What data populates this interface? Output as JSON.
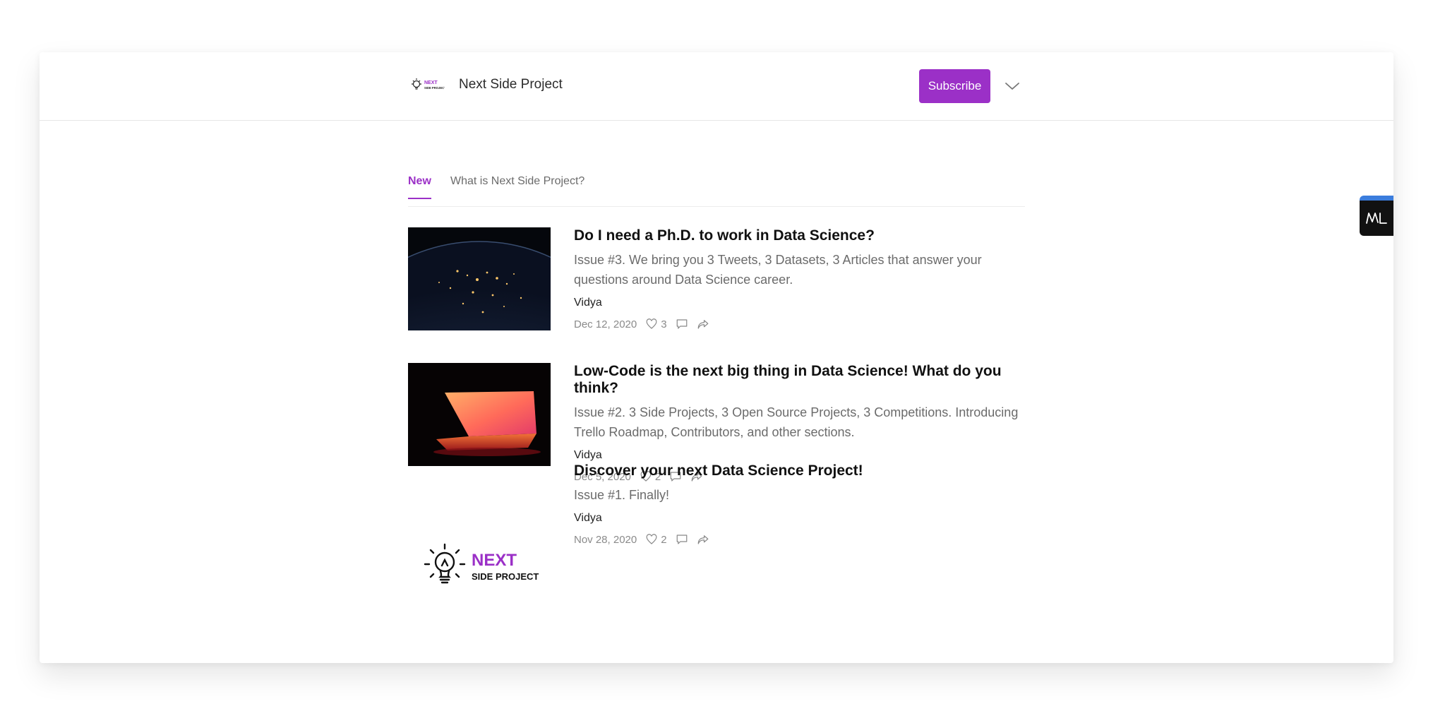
{
  "header": {
    "site_title": "Next Side Project",
    "subscribe_label": "Subscribe",
    "logo_text_top": "NEXT",
    "logo_text_bottom": "SIDE PROJECT"
  },
  "tabs": [
    {
      "label": "New",
      "active": true
    },
    {
      "label": "What is Next Side Project?",
      "active": false
    }
  ],
  "posts": [
    {
      "title": "Do I need a Ph.D. to work in Data Science?",
      "subtitle": "Issue #3. We bring you 3 Tweets, 3 Datasets, 3 Articles that answer your questions around Data Science career.",
      "author": "Vidya",
      "date": "Dec 12, 2020",
      "likes": "3",
      "thumbnail": "earth-at-night"
    },
    {
      "title": "Low-Code is the next big thing in Data Science! What do you think?",
      "subtitle": "Issue #2. 3 Side Projects, 3 Open Source Projects, 3 Competitions. Introducing Trello Roadmap, Contributors, and other sections.",
      "author": "Vidya",
      "date": "Dec 5, 2020",
      "likes": "2",
      "thumbnail": "glowing-laptop"
    },
    {
      "title": "Discover your next Data Science Project!",
      "subtitle": "Issue #1. Finally!",
      "author": "Vidya",
      "date": "Nov 28, 2020",
      "likes": "2",
      "thumbnail": "next-side-project-logo"
    }
  ],
  "icons": {
    "like": "heart-icon",
    "comment": "comment-icon",
    "share": "share-icon",
    "menu": "chevron-down-icon",
    "side_badge": "m-logo-icon"
  },
  "colors": {
    "accent": "#9b30c7",
    "badge_top": "#3b7ddd"
  }
}
